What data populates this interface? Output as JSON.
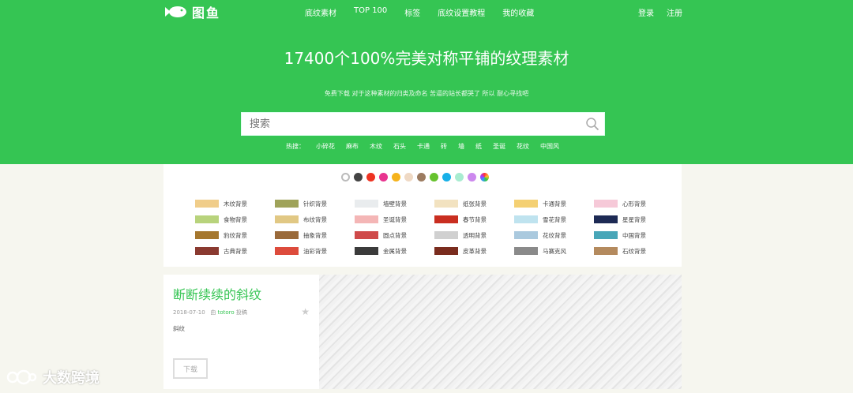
{
  "header": {
    "logo_text": "图鱼",
    "nav": [
      "底纹素材",
      "TOP 100",
      "标签",
      "底纹设置教程",
      "我的收藏"
    ],
    "login": "登录",
    "register": "注册"
  },
  "hero": {
    "title": "17400个100%完美对称平铺的纹理素材",
    "subtitle": "免费下载 对于这种素材的归类及命名 苦逼的站长都哭了 所以 耐心寻找吧",
    "search_placeholder": "搜索",
    "hot_label": "热搜：",
    "hot_tags": [
      "小碎花",
      "麻布",
      "木纹",
      "石头",
      "卡通",
      "砖",
      "墙",
      "纸",
      "圣诞",
      "花纹",
      "中国风"
    ]
  },
  "color_swatches": [
    "#ffffff",
    "#444444",
    "#ee3322",
    "#e8348f",
    "#f5b31c",
    "#efd9c4",
    "#9c7b60",
    "#66c22d",
    "#18b0e8",
    "#a8ecd0",
    "#cc88ee",
    "rainbow"
  ],
  "categories": [
    {
      "label": "木纹背景",
      "color": "#f0cd8a"
    },
    {
      "label": "针织背景",
      "color": "#9fa35a"
    },
    {
      "label": "墙壁背景",
      "color": "#e9ecee"
    },
    {
      "label": "纸张背景",
      "color": "#f2e2c0"
    },
    {
      "label": "卡通背景",
      "color": "#f4d073"
    },
    {
      "label": "心形背景",
      "color": "#f6c9d8"
    },
    {
      "label": "食物背景",
      "color": "#b8d37c"
    },
    {
      "label": "布纹背景",
      "color": "#e1c884"
    },
    {
      "label": "圣诞背景",
      "color": "#f4b6b6"
    },
    {
      "label": "春节背景",
      "color": "#c92e20"
    },
    {
      "label": "雪花背景",
      "color": "#bfe3ef"
    },
    {
      "label": "星星背景",
      "color": "#1d2a54"
    },
    {
      "label": "豹纹背景",
      "color": "#a5772e"
    },
    {
      "label": "抽象背景",
      "color": "#9a6a3a"
    },
    {
      "label": "圆点背景",
      "color": "#cf4a4a"
    },
    {
      "label": "透明背景",
      "color": "#d0d0d0"
    },
    {
      "label": "花纹背景",
      "color": "#aac9de"
    },
    {
      "label": "中国背景",
      "color": "#48a6b8"
    },
    {
      "label": "古典背景",
      "color": "#8a3a30"
    },
    {
      "label": "油彩背景",
      "color": "#dd4b3c"
    },
    {
      "label": "金属背景",
      "color": "#3b3b3b"
    },
    {
      "label": "皮革背景",
      "color": "#7a2c1e"
    },
    {
      "label": "马赛克风",
      "color": "#8a8a8a"
    },
    {
      "label": "石纹背景",
      "color": "#b48a5e"
    }
  ],
  "card": {
    "title": "断断续续的斜纹",
    "date": "2018-07-10",
    "by": "由",
    "author": "totoro",
    "posted": "投稿",
    "tag": "斜纹",
    "download": "下载"
  },
  "watermark": "大数跨境"
}
